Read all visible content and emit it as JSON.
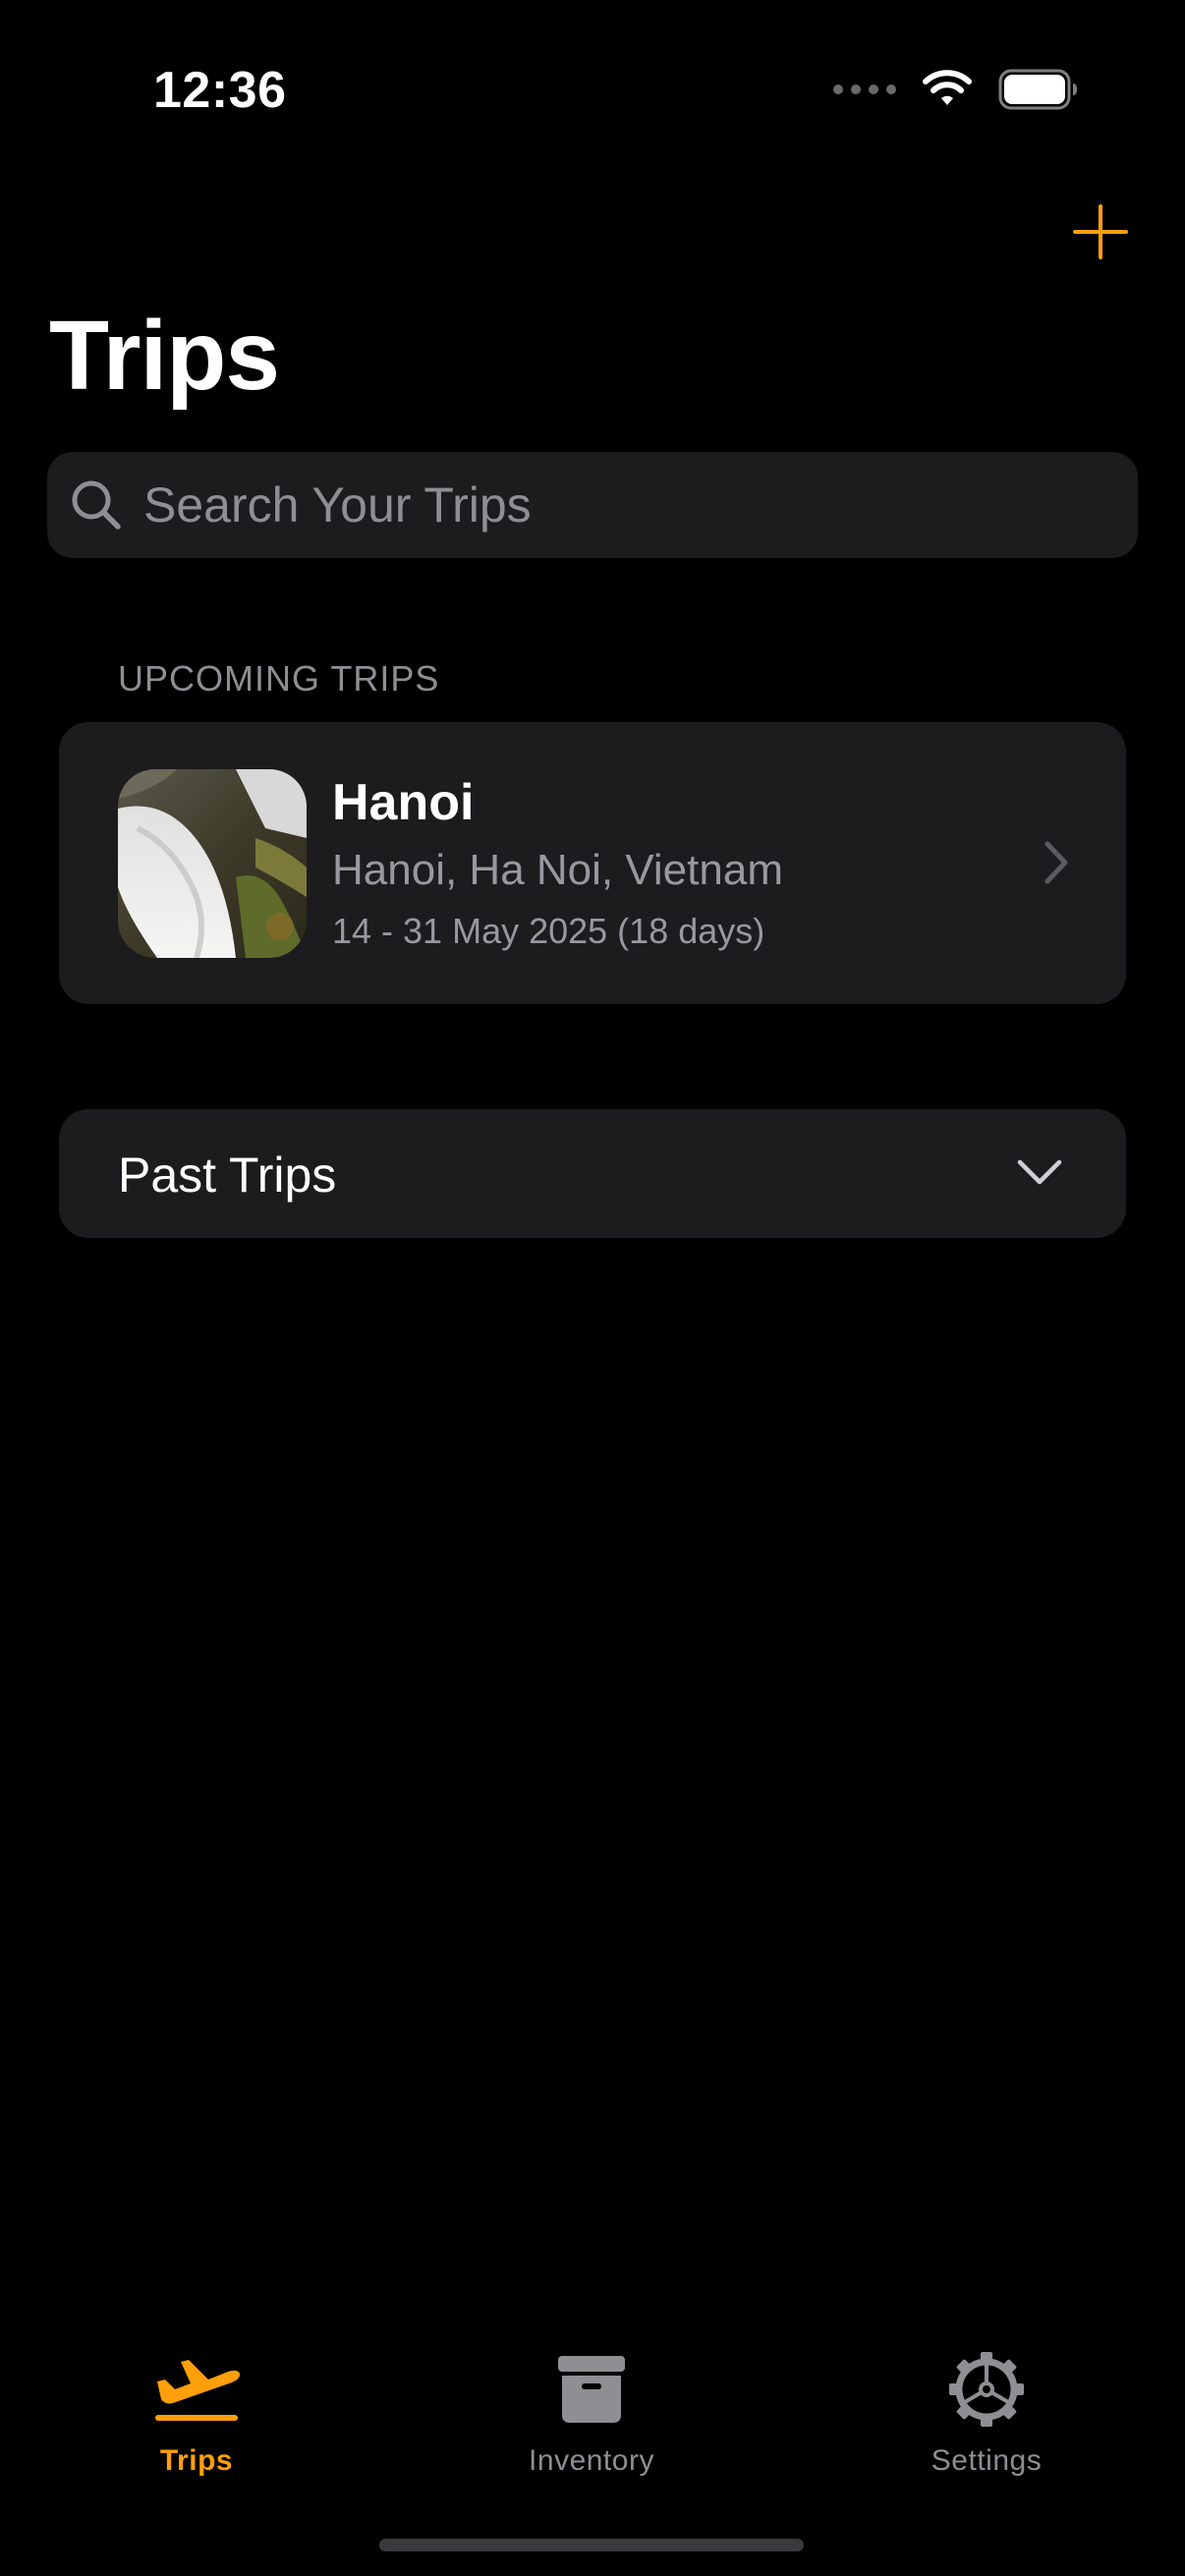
{
  "status_bar": {
    "time": "12:36"
  },
  "header": {
    "title": "Trips",
    "add_icon": "plus-icon"
  },
  "search": {
    "placeholder": "Search Your Trips",
    "value": ""
  },
  "upcoming": {
    "section_label": "UPCOMING TRIPS",
    "trips": [
      {
        "name": "Hanoi",
        "location": "Hanoi, Ha Noi, Vietnam",
        "dates": "14 - 31 May 2025 (18 days)",
        "image": "waterfall-photo"
      }
    ]
  },
  "past": {
    "label": "Past Trips"
  },
  "tab_bar": {
    "items": [
      {
        "label": "Trips",
        "icon": "airplane-departure-icon",
        "active": true
      },
      {
        "label": "Inventory",
        "icon": "archive-box-icon",
        "active": false
      },
      {
        "label": "Settings",
        "icon": "gear-icon",
        "active": false
      }
    ]
  },
  "colors": {
    "accent": "#ff9f0a",
    "background": "#000000",
    "card": "#1c1c1e",
    "secondary_text": "#8e8e93"
  }
}
